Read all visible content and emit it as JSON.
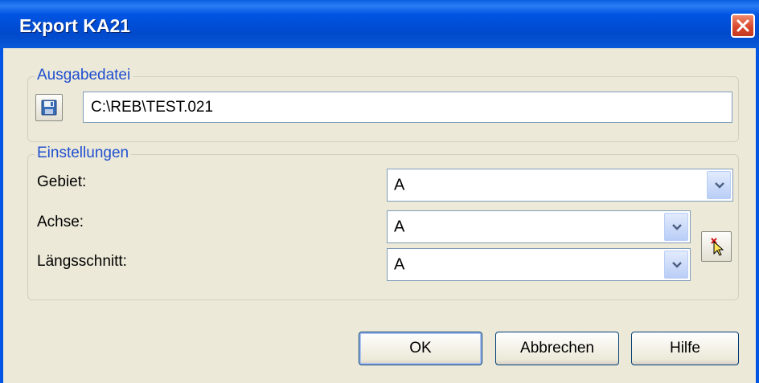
{
  "window": {
    "title": "Export KA21",
    "close_icon": "close-icon"
  },
  "output_group": {
    "legend": "Ausgabedatei",
    "file_path": "C:\\REB\\TEST.021",
    "save_icon": "floppy-disk-icon"
  },
  "settings_group": {
    "legend": "Einstellungen",
    "gebiet": {
      "label": "Gebiet:",
      "value": "A"
    },
    "achse": {
      "label": "Achse:",
      "value": "A"
    },
    "laengsschnitt": {
      "label": "Längsschnitt:",
      "value": "A"
    },
    "pick_icon": "pick-cursor-icon"
  },
  "buttons": {
    "ok": "OK",
    "cancel": "Abbrechen",
    "help": "Hilfe"
  },
  "colors": {
    "titlebar": "#0054e3",
    "legend_text": "#1f4fd0",
    "dialog_bg": "#ece9d8"
  }
}
